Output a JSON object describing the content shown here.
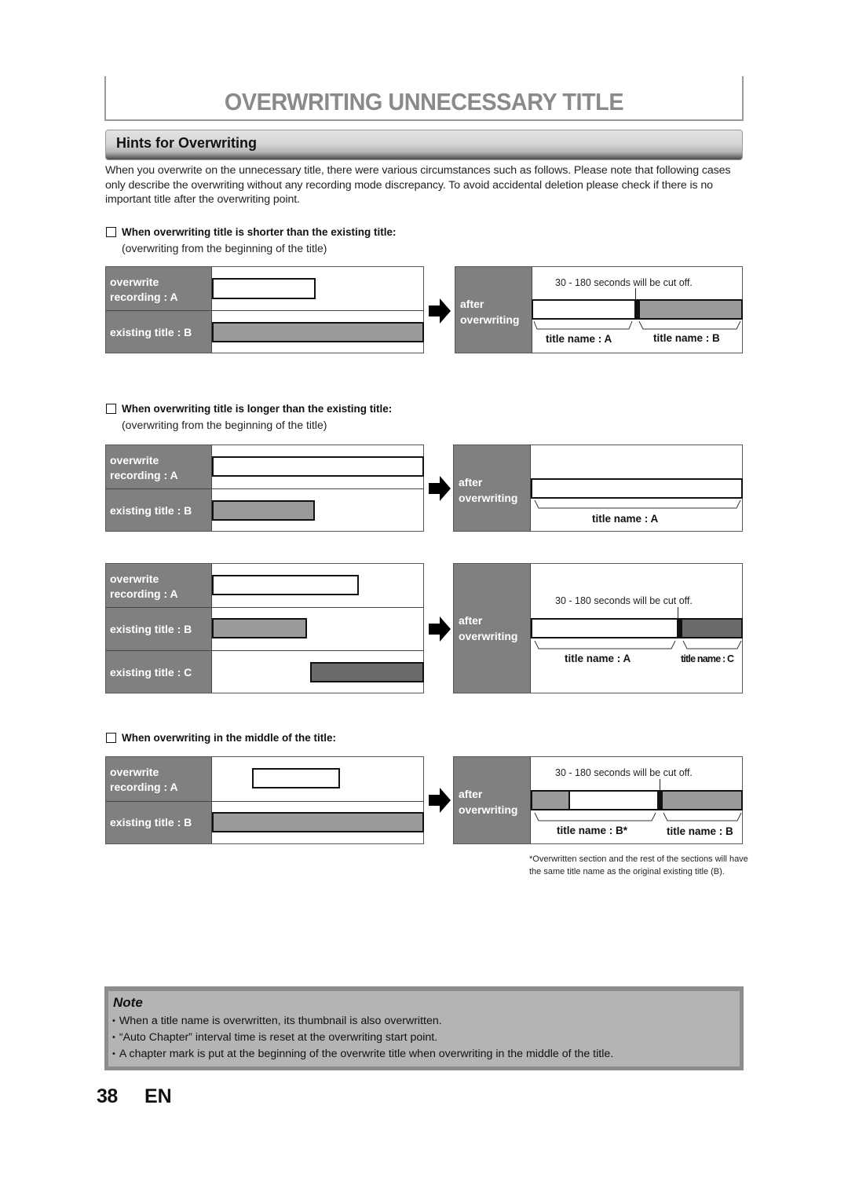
{
  "page": {
    "title": "OVERWRITING UNNECESSARY TITLE",
    "section_title": "Hints for Overwriting",
    "intro": "When you overwrite on the unnecessary title, there were various circumstances such as follows.  Please note that following cases only describe the overwriting without any recording mode discrepancy.  To avoid accidental deletion please check if there is no important title after the overwriting point.",
    "page_number": "38",
    "language": "EN"
  },
  "colors": {
    "label_bg": "#808080",
    "existing_title_fill": "#9a9a9a",
    "existing_title_c_fill": "#6a6a6a",
    "note_bg": "#b4b4b4",
    "title_text": "#8a8a8a"
  },
  "labels": {
    "overwrite_line1": "overwrite",
    "overwrite_line2": "recording : A",
    "existing_b": "existing title : B",
    "existing_c": "existing title : C",
    "after_line1": "after",
    "after_line2": "overwriting",
    "cut_off": "30 - 180 seconds will be cut off.",
    "title_name_a": "title name : A",
    "title_name_b": "title name : B",
    "title_name_c": "title name : C",
    "title_name_b_star": "title name : B*"
  },
  "cases": [
    {
      "heading": "When overwriting title is shorter than the existing title:",
      "subheading": "(overwriting from the beginning of the title)"
    },
    {
      "heading": "When overwriting title is longer than the existing title:",
      "subheading": "(overwriting from the beginning of the title)"
    },
    {
      "heading": "When overwriting in the middle of the title:",
      "subheading": ""
    }
  ],
  "footnote": "*Overwritten section and the rest of the sections will have the same title name as the original existing title (B).",
  "note": {
    "title": "Note",
    "items": [
      "When a title name is overwritten, its thumbnail is also overwritten.",
      "“Auto Chapter” interval time is reset at the overwriting start point.",
      "A chapter mark is put at the beginning of the overwrite title when overwriting in the middle of the title."
    ]
  }
}
